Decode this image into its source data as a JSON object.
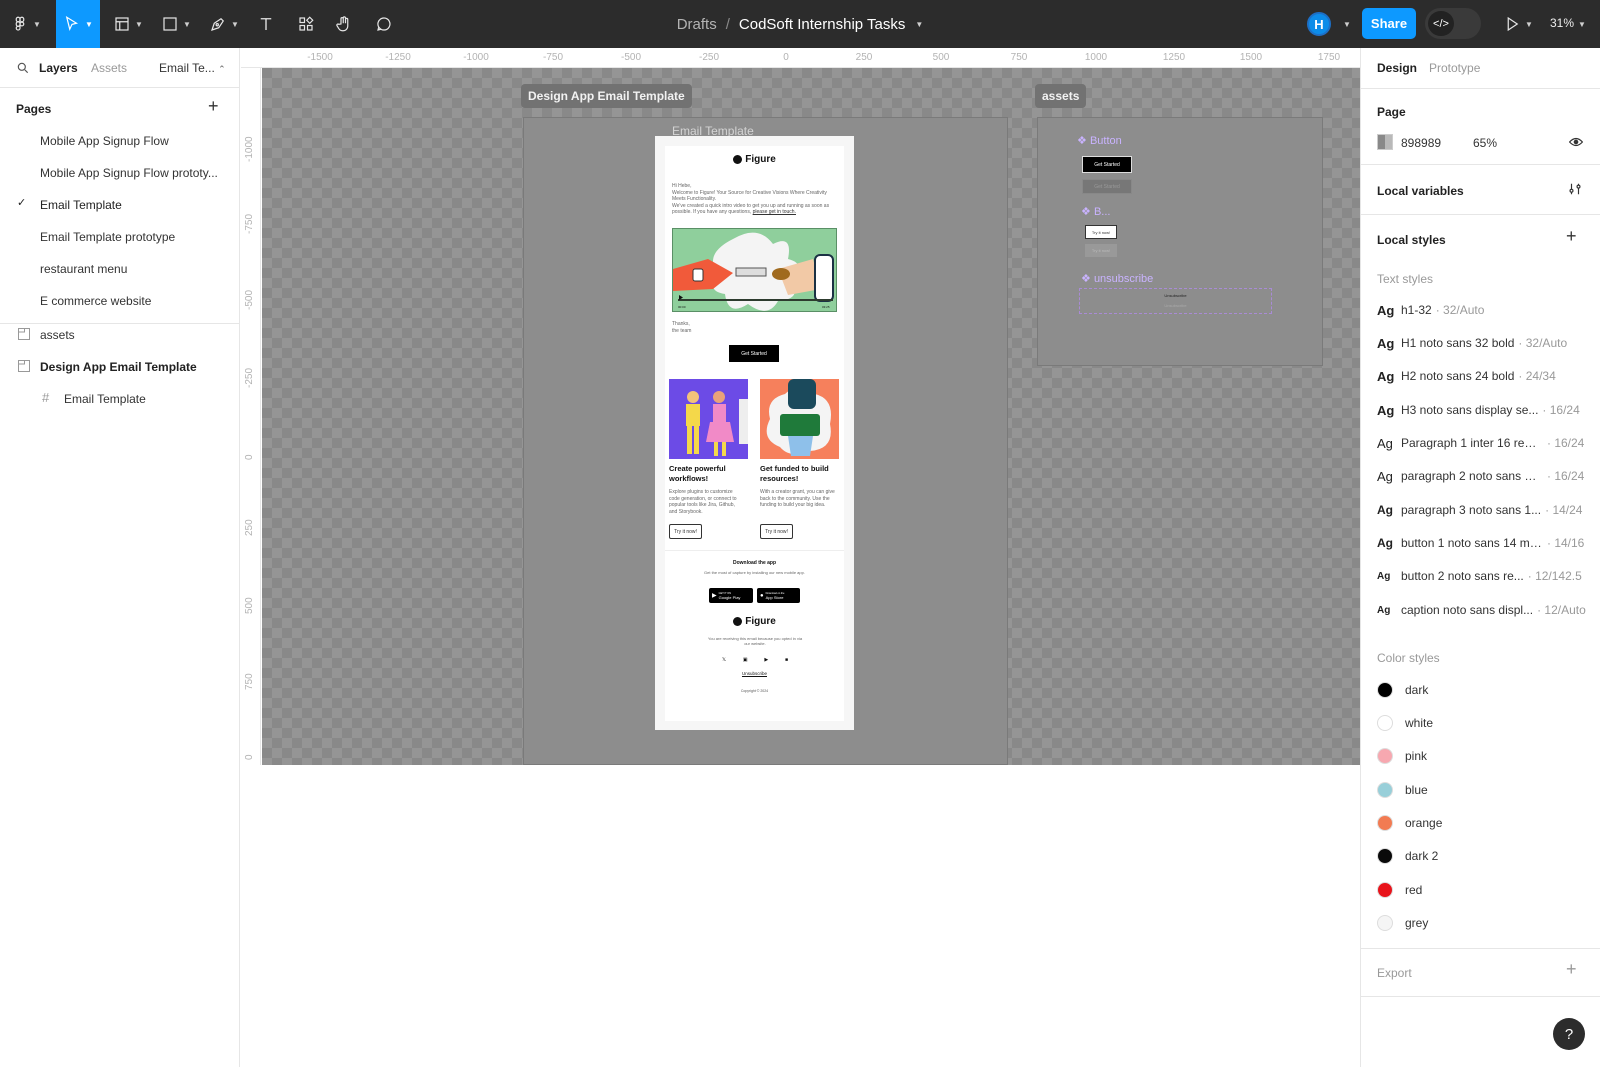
{
  "toolbar": {
    "breadcrumb_drafts": "Drafts",
    "breadcrumb_sep": "/",
    "file_name": "CodSoft Internship Tasks",
    "share_label": "Share",
    "avatar_initial": "H",
    "zoom": "31%",
    "accent": "#0d99ff"
  },
  "left_panel": {
    "tab_layers": "Layers",
    "tab_assets": "Assets",
    "page_dropdown": "Email Te...",
    "pages_title": "Pages",
    "pages": [
      {
        "label": "Mobile App Signup Flow"
      },
      {
        "label": "Mobile App Signup Flow prototy..."
      },
      {
        "label": "Email Template",
        "selected": true
      },
      {
        "label": "Email Template prototype"
      },
      {
        "label": "restaurant menu"
      },
      {
        "label": "E commerce website"
      }
    ],
    "layers": [
      {
        "label": "assets"
      },
      {
        "label": "Design App Email Template"
      },
      {
        "label": "Email Template"
      }
    ]
  },
  "rulers": {
    "top": [
      "-1500",
      "-1250",
      "-1000",
      "-750",
      "-500",
      "-250",
      "0",
      "250",
      "500",
      "750",
      "1000",
      "1250",
      "1500",
      "1750"
    ],
    "left": [
      "-1000",
      "-750",
      "-500",
      "-250",
      "0",
      "250",
      "500",
      "750",
      "0"
    ]
  },
  "canvas": {
    "section_main": "Design App Email Template",
    "section_assets": "assets",
    "frame_label": "Email Template",
    "assets_components": {
      "button": "Button",
      "button_label1": "Get Started",
      "button_label2": "Get Started",
      "b2": "B...",
      "b2_label1": "Try it now!",
      "b2_label2": "Try it now!",
      "unsubscribe": "unsubscribe",
      "unsubscribe_label1": "Unsubscribe",
      "unsubscribe_label2": "Unsubscribe"
    }
  },
  "email": {
    "brand": "Figure",
    "greeting": "Hi Hebe,",
    "body1": "Welcome to Figure! Your Source for Creative Visions Where Creativity Meets Functionality.",
    "body2": "We've created a quick intro video to get you up and running as soon as possible. If you have any questions,",
    "body_link": "please get in touch.",
    "video_time_start": "00:00",
    "video_time_end": "03:25",
    "signoff1": "Thanks,",
    "signoff2": "the team",
    "cta": "Get Started",
    "card1_title": "Create powerful workflows!",
    "card1_body": "Explore plugins to customize code generation, or connect to popular tools like Jira, Github, and Storybook.",
    "card1_btn": "Try it now!",
    "card2_title": "Get funded to build resources!",
    "card2_body": "With a creator grant, you can give back to the community. Use the funding to build your big idea.",
    "card2_btn": "Try it now!",
    "download_title": "Download the app",
    "download_sub": "Get the most of capture by installing our new mobile app.",
    "store1": "Google Play",
    "store1_small": "GET IT ON",
    "store2": "App Store",
    "store2_small": "Download on the",
    "footer_brand": "Figure",
    "footer_note": "You are receiving this email because you opted in via our website.",
    "unsubscribe": "Unsubscribe",
    "copyright": "Copyright © 2024"
  },
  "right_panel": {
    "tab_design": "Design",
    "tab_prototype": "Prototype",
    "page_title": "Page",
    "page_color": "898989",
    "page_opacity": "65%",
    "local_variables": "Local variables",
    "local_styles": "Local styles",
    "text_styles_title": "Text styles",
    "text_styles": [
      {
        "ag": "Ag",
        "name": "h1-32",
        "spec": "· 32/Auto"
      },
      {
        "ag": "Ag",
        "name": "H1 noto sans 32 bold",
        "spec": "· 32/Auto"
      },
      {
        "ag": "Ag",
        "name": "H2 noto sans 24 bold",
        "spec": "· 24/34"
      },
      {
        "ag": "Ag",
        "name": "H3 noto sans display se...",
        "spec": "· 16/24"
      },
      {
        "ag": "Ag",
        "name": "Paragraph 1 inter 16 regu...",
        "spec": "· 16/24"
      },
      {
        "ag": "Ag",
        "name": "paragraph 2 noto sans 16...",
        "spec": "· 16/24"
      },
      {
        "ag": "Ag",
        "name": "paragraph 3 noto sans 1...",
        "spec": "· 14/24"
      },
      {
        "ag": "Ag",
        "name": "button 1 noto sans 14 me...",
        "spec": "· 14/16"
      },
      {
        "ag": "Ag",
        "name": "button 2 noto sans re...",
        "spec": "· 12/142.5"
      },
      {
        "ag": "Ag",
        "name": "caption noto sans displ...",
        "spec": "· 12/Auto"
      }
    ],
    "color_styles_title": "Color styles",
    "color_styles": [
      {
        "name": "dark",
        "color": "#000000"
      },
      {
        "name": "white",
        "color": "#ffffff"
      },
      {
        "name": "pink",
        "color": "#f7a8b0"
      },
      {
        "name": "blue",
        "color": "#98cfd9"
      },
      {
        "name": "orange",
        "color": "#f27b52"
      },
      {
        "name": "dark 2",
        "color": "#0a0a0a"
      },
      {
        "name": "red",
        "color": "#e8131b"
      },
      {
        "name": "grey",
        "color": "#f5f5f5"
      }
    ],
    "export": "Export",
    "help": "?"
  }
}
